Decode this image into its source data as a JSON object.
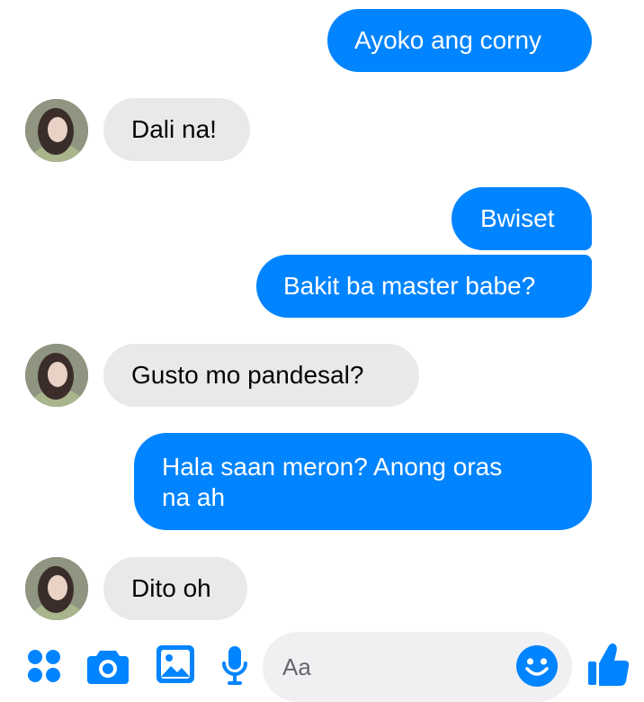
{
  "colors": {
    "outgoing_bubble": "#0084ff",
    "incoming_bubble": "#e9e9eb",
    "accent": "#0084ff",
    "composer_background": "#f0f0f2"
  },
  "conversation": {
    "messages": [
      {
        "direction": "outgoing",
        "text": "Ayoko ang corny"
      },
      {
        "direction": "incoming",
        "text": "Dali na!"
      },
      {
        "direction": "outgoing",
        "text": "Bwiset"
      },
      {
        "direction": "outgoing",
        "text": "Bakit ba master babe?"
      },
      {
        "direction": "incoming",
        "text": "Gusto mo pandesal?"
      },
      {
        "direction": "outgoing",
        "text": "Hala saan meron? Anong oras\nna ah"
      },
      {
        "direction": "incoming",
        "text": "Dito oh"
      }
    ]
  },
  "composer": {
    "placeholder": "Aa",
    "icons": {
      "more": "four-dots-icon",
      "camera": "camera-icon",
      "gallery": "image-icon",
      "voice": "microphone-icon",
      "emoji": "smiley-icon",
      "like": "thumbs-up-icon"
    }
  }
}
